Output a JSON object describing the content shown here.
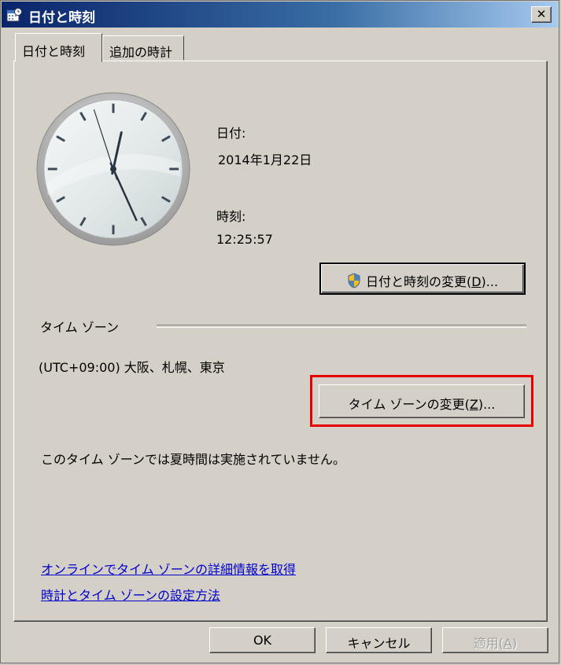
{
  "window": {
    "title": "日付と時刻",
    "close_label": "✕"
  },
  "tabs": [
    {
      "label": "日付と時刻",
      "active": true
    },
    {
      "label": "追加の時計",
      "active": false
    }
  ],
  "datetime": {
    "date_label": "日付:",
    "date_value": "2014年1月22日",
    "time_label": "時刻:",
    "time_value": "12:25:57",
    "clock": {
      "hour": 12,
      "minute": 25,
      "second": 57
    },
    "change_button_label": "日付と時刻の変更(",
    "change_button_accel": "D",
    "change_button_suffix": ")..."
  },
  "timezone": {
    "group_label": "タイム ゾーン",
    "current_zone": "(UTC+09:00) 大阪、札幌、東京",
    "change_button_label": "タイム ゾーンの変更(",
    "change_button_accel": "Z",
    "change_button_suffix": ")...",
    "dst_note": "このタイム ゾーンでは夏時間は実施されていません。"
  },
  "links": [
    "オンラインでタイム ゾーンの詳細情報を取得",
    "時計とタイム ゾーンの設定方法"
  ],
  "footer": {
    "ok_label": "OK",
    "cancel_label": "キャンセル",
    "apply_label": "適用(",
    "apply_accel": "A",
    "apply_suffix": ")"
  },
  "colors": {
    "highlight": "#e60000",
    "link": "#0000cc"
  }
}
